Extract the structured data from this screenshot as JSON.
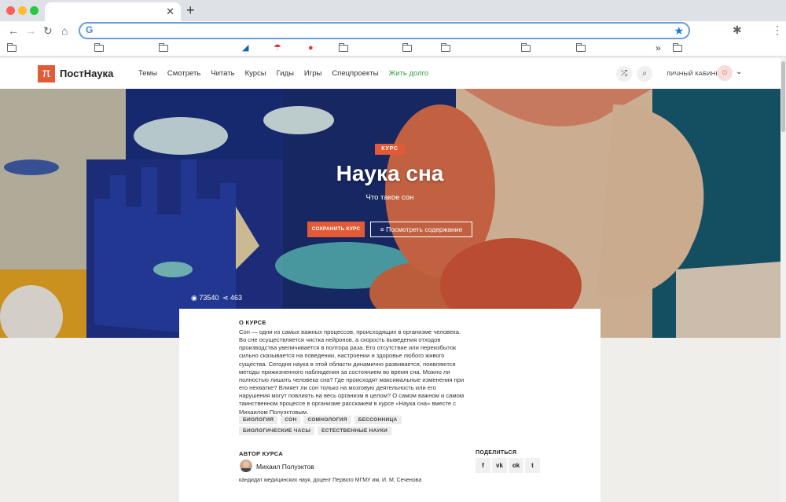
{
  "browser": {
    "address_value": "",
    "window_buttons_colors": [
      "#ff5f57",
      "#febc2e",
      "#28c840"
    ]
  },
  "site": {
    "logo_mark": "π",
    "logo_text": "ПостНаука",
    "nav": [
      "Темы",
      "Смотреть",
      "Читать",
      "Курсы",
      "Гиды",
      "Игры",
      "Спецпроекты",
      "Жить долго"
    ],
    "nav_highlight_color": "#2e9c45",
    "cabinet_label": "ЛИЧНЫЙ КАБИНЕТ",
    "accent_color": "#e25b36"
  },
  "hero": {
    "badge": "КУРС",
    "title": "Наука сна",
    "subtitle": "Что такое сон",
    "save_button": "СОХРАНИТЬ КУРС",
    "contents_button": "Посмотреть содержание",
    "views": "73540",
    "shares": "463"
  },
  "about": {
    "heading": "О КУРСЕ",
    "text": "Сон — одни из самых важных процессов, происходящих в организме человека. Во сне осуществляется чистка нейронов, а скорость выведения отходов производства увеличивается в полтора раза. Его отсутствие или переизбыток сильно сказывается на поведении, настроении и здоровье любого живого существа. Сегодня наука в этой области динамично развивается, появляются методы прижизненного наблюдения за состоянием во время сна. Можно ли полностью лишить человека сна? Где происходят максимальные изменения при его нехватке? Влияет ли сон только на мозговую деятельность или его нарушения могут повлиять на весь организм в целом? О самом важном и самом таинственном процессе в организме расскажем в курсе «Наука сна» вместе с Михаилом Полуэктовым.",
    "tags": [
      "БИОЛОГИЯ",
      "СОН",
      "СОМНОЛОГИЯ",
      "БЕССОННИЦА",
      "БИОЛОГИЧЕСКИЕ ЧАСЫ",
      "ЕСТЕСТВЕННЫЕ НАУКИ"
    ]
  },
  "author": {
    "heading": "АВТОР КУРСА",
    "name": "Михаил Полуэктов",
    "description": "кандидат медицинских наук, доцент Первого МГМУ им. И. М. Сеченова"
  },
  "share": {
    "heading": "ПОДЕЛИТЬСЯ",
    "networks": [
      "facebook-icon",
      "vk-icon",
      "odnoklassniki-icon",
      "twitter-icon"
    ],
    "labels": [
      "f",
      "vk",
      "ok",
      "t"
    ]
  }
}
